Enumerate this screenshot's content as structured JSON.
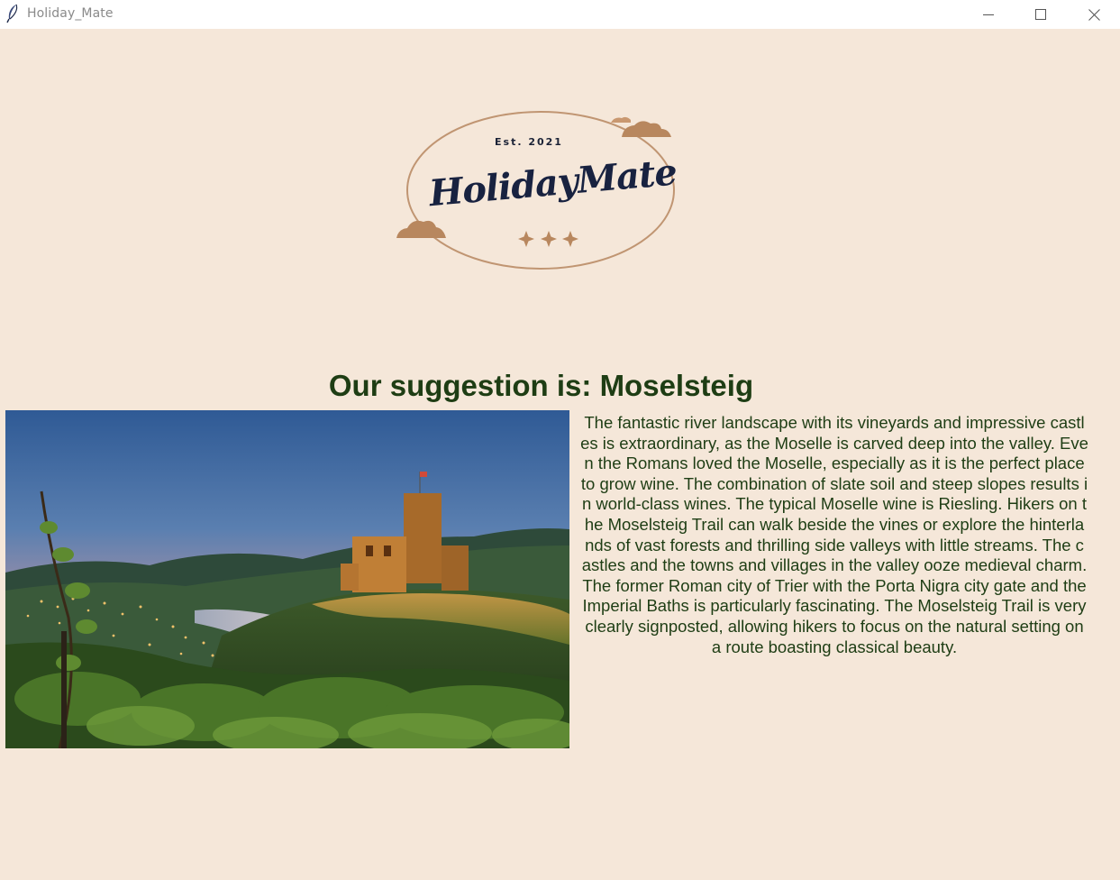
{
  "window": {
    "title": "Holiday_Mate",
    "icon": "feather-icon",
    "controls": [
      "minimize-icon",
      "maximize-icon",
      "close-icon"
    ]
  },
  "logo": {
    "established": "Est. 2021",
    "name": "HolidayMate",
    "decoration": [
      "cloud-icon",
      "cloud-icon",
      "star-icon",
      "star-icon",
      "star-icon"
    ]
  },
  "suggestion": {
    "title": "Our suggestion is: Moselsteig",
    "image": "castle-vineyard-landscape",
    "description": "The fantastic river landscape with its vineyards and impressive castles is extraordinary, as the Moselle is carved deep into the valley. Even the Romans loved the Moselle, especially as it is the perfect place to grow wine. The combination of slate soil and steep slopes results in world-class wines. The typical Moselle wine is Riesling. Hikers on the Moselsteig Trail can walk beside the vines or explore the hinterlands of vast forests and thrilling side valleys with little streams. The castles and the towns and villages in the valley ooze medieval charm. The former Roman city of Trier with the Porta Nigra city gate and the Imperial Baths is particularly fascinating. The Moselsteig Trail is very clearly signposted, allowing hikers to focus on the natural setting on a route boasting classical beauty."
  },
  "colors": {
    "background": "#f5e7d9",
    "text": "#1e3d14",
    "logo_navy": "#182240",
    "logo_bronze": "#b88a62"
  }
}
